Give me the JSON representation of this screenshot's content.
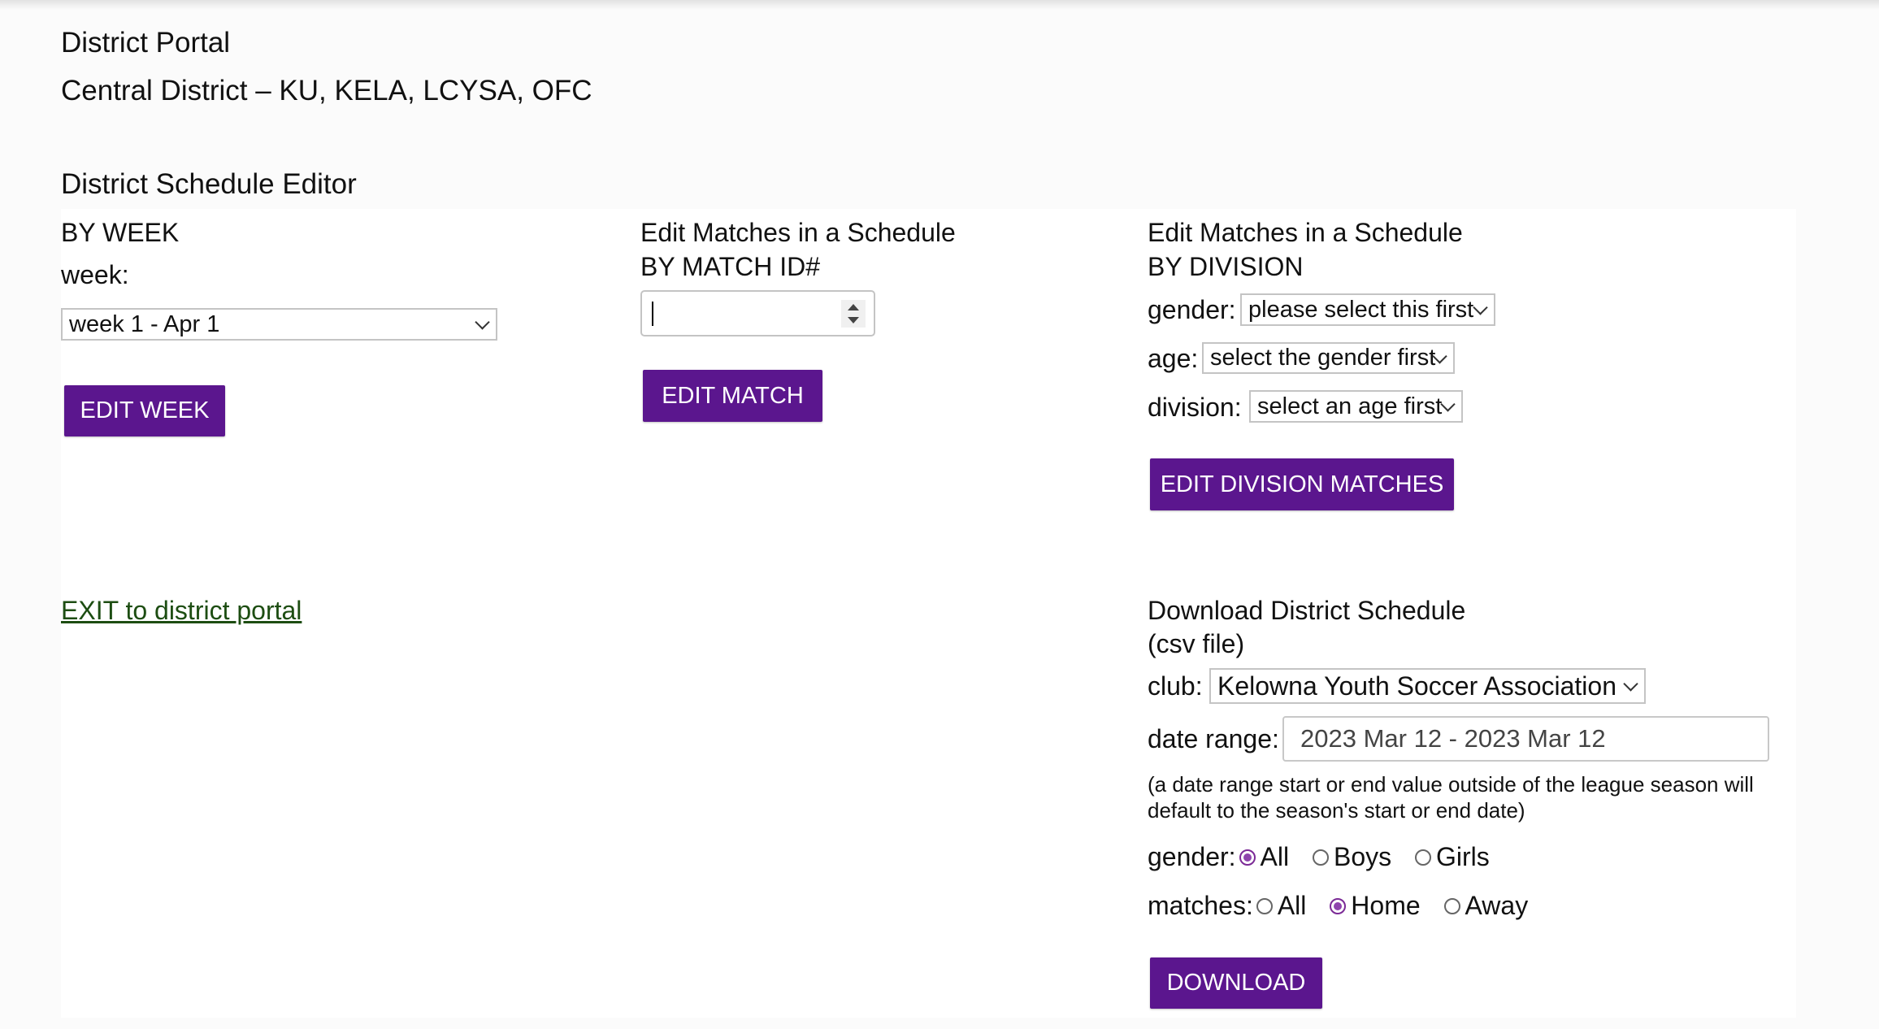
{
  "header": {
    "title": "District Portal",
    "district": "Central District – KU, KELA, LCYSA, OFC",
    "section_title": "District Schedule Editor"
  },
  "by_week": {
    "heading": "BY WEEK",
    "week_label": "week:",
    "week_selected": "week 1 - Apr 1",
    "button": "EDIT WEEK"
  },
  "by_match": {
    "heading_line1": "Edit Matches in a Schedule",
    "heading_line2": "BY MATCH ID#",
    "match_id_value": "",
    "button": "EDIT MATCH"
  },
  "by_division": {
    "heading_line1": "Edit Matches in a Schedule",
    "heading_line2": "BY DIVISION",
    "gender_label": "gender:",
    "gender_selected": "please select this first",
    "age_label": "age:",
    "age_selected": "select the gender first",
    "division_label": "division:",
    "division_selected": "select an age first",
    "button": "EDIT DIVISION MATCHES"
  },
  "exit_link": "EXIT to district portal",
  "download": {
    "heading_line1": "Download District Schedule",
    "heading_line2": "(csv file)",
    "club_label": "club:",
    "club_selected": "Kelowna Youth Soccer Association",
    "date_range_label": "date range:",
    "date_range_value": "2023 Mar 12 - 2023 Mar 12",
    "note_line1": "(a date range start or end value outside of the league season will",
    "note_line2": "default to the season's start or end date)",
    "gender_label": "gender:",
    "gender_options": [
      {
        "label": "All",
        "selected": true
      },
      {
        "label": "Boys",
        "selected": false
      },
      {
        "label": "Girls",
        "selected": false
      }
    ],
    "matches_label": "matches:",
    "matches_options": [
      {
        "label": "All",
        "selected": false
      },
      {
        "label": "Home",
        "selected": true
      },
      {
        "label": "Away",
        "selected": false
      }
    ],
    "button": "DOWNLOAD"
  },
  "colors": {
    "button_bg": "#5b168e",
    "link": "#1d4d12",
    "radio_selected": "#8e44ad"
  }
}
